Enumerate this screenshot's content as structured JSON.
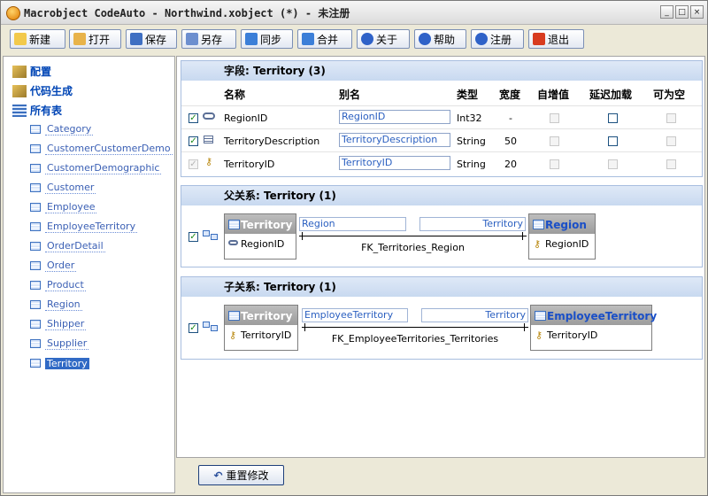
{
  "window": {
    "title": "Macrobject CodeAuto - Northwind.xobject (*) - 未注册",
    "buttons": {
      "minimize": "_",
      "maximize": "□",
      "close": "×"
    }
  },
  "toolbar": {
    "items": [
      {
        "label": "新建",
        "icon": "new-icon",
        "color": "#f2c94c"
      },
      {
        "label": "打开",
        "icon": "open-folder-icon",
        "color": "#e8b34a"
      },
      {
        "label": "保存",
        "icon": "save-icon",
        "color": "#3f6fc2"
      },
      {
        "label": "另存",
        "icon": "save-as-icon",
        "color": "#6d8fcf"
      },
      {
        "label": "同步",
        "icon": "sync-icon",
        "color": "#3c7fd8"
      },
      {
        "label": "合并",
        "icon": "merge-icon",
        "color": "#3c7fd8"
      },
      {
        "label": "关于",
        "icon": "info-icon",
        "color": "#2f62c8"
      },
      {
        "label": "帮助",
        "icon": "help-icon",
        "color": "#2f62c8"
      },
      {
        "label": "注册",
        "icon": "register-icon",
        "color": "#2f62c8"
      },
      {
        "label": "退出",
        "icon": "exit-icon",
        "color": "#d83b1f"
      }
    ]
  },
  "sidebar": {
    "roots": [
      {
        "label": "配置",
        "icon": "config-icon"
      },
      {
        "label": "代码生成",
        "icon": "codegen-icon"
      },
      {
        "label": "所有表",
        "icon": "tables-icon"
      }
    ],
    "tables": [
      "Category",
      "CustomerCustomerDemo",
      "CustomerDemographic",
      "Customer",
      "Employee",
      "EmployeeTerritory",
      "OrderDetail",
      "Order",
      "Product",
      "Region",
      "Shipper",
      "Supplier",
      "Territory"
    ],
    "selected": "Territory"
  },
  "fields": {
    "title": "字段: Territory (3)",
    "headers": {
      "name": "名称",
      "alias": "别名",
      "type": "类型",
      "width": "宽度",
      "identity": "自增值",
      "lazy": "延迟加载",
      "nullable": "可为空"
    },
    "rows": [
      {
        "checked": true,
        "icon": "relation-link-icon",
        "name": "RegionID",
        "alias": "RegionID",
        "type": "Int32",
        "width": "-"
      },
      {
        "checked": true,
        "icon": "text-field-icon",
        "name": "TerritoryDescription",
        "alias": "TerritoryDescription",
        "type": "String",
        "width": "50"
      },
      {
        "checked": true,
        "icon": "primary-key-icon",
        "name": "TerritoryID",
        "alias": "TerritoryID",
        "type": "String",
        "width": "20"
      }
    ]
  },
  "parent_relations": {
    "title": "父关系: Territory (1)",
    "items": [
      {
        "from_table": "Territory",
        "from_key": "RegionID",
        "from_alias": "Region",
        "to_alias": "Territory",
        "fk": "FK_Territories_Region",
        "to_table": "Region",
        "to_key": "RegionID"
      }
    ]
  },
  "child_relations": {
    "title": "子关系: Territory (1)",
    "items": [
      {
        "from_table": "Territory",
        "from_key": "TerritoryID",
        "from_alias": "EmployeeTerritory",
        "to_alias": "Territory",
        "fk": "FK_EmployeeTerritories_Territories",
        "to_table": "EmployeeTerritory",
        "to_key": "TerritoryID"
      }
    ]
  },
  "footer": {
    "reset_label": "重置修改"
  }
}
